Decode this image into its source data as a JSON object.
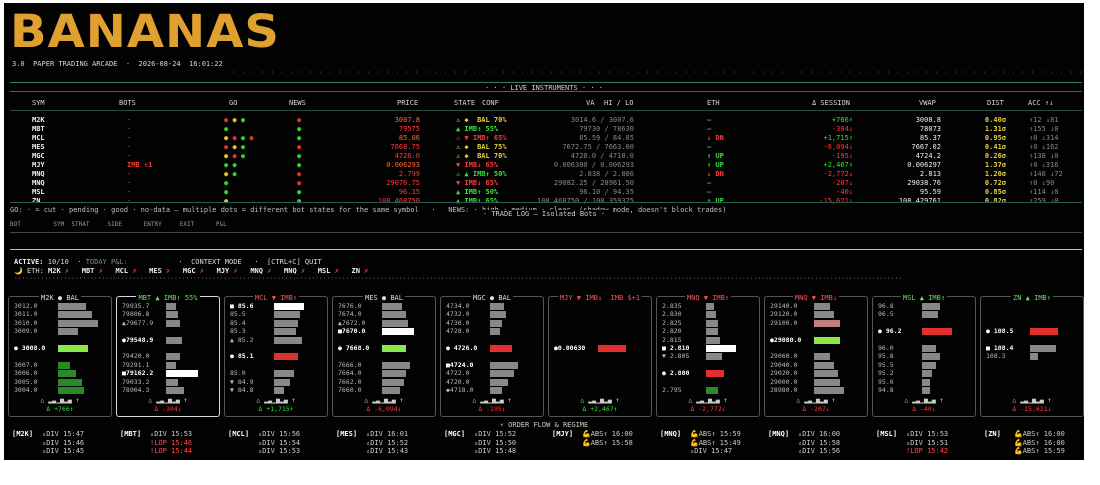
{
  "header": {
    "logo": "BANANAS",
    "version": "3.0",
    "subtitle": "PAPER TRADING ARCADE",
    "separator": "·",
    "datetime": "2026-08-24  16:01:22",
    "dots": "· · · · · · · · · · · · · · · · · · · · · · · · · · · · · · · · · · · · · · · · · · · · · · · · · · · · · · · · · · · · · · · · · · · · · · · · · · · · · · · · · · · · · · · · · · · · · · · · · · · · · · · · · · · · · · · · · · · · · · · · · · · · · · ·"
  },
  "live": {
    "title": "· · · LIVE INSTRUMENTS · · ·",
    "columns": [
      "SYM",
      "BOTS",
      "GO",
      "NEWS",
      "PRICE",
      "STATE",
      "CONF",
      "VA",
      "HI / LO",
      "ETH",
      "Δ SESSION",
      "VWAP",
      "DIST",
      "ACC ↑↓"
    ],
    "rows": [
      {
        "sym": "M2K",
        "bots": "·",
        "go": "● ● ●",
        "news": "●",
        "price": "3007.8",
        "state": "⚠ ◆  BAL 70%",
        "va": "3014.6 / 3007.6",
        "hilo": "",
        "eth": "—",
        "delta": "+766↑",
        "vwap": "3008.8",
        "dist": "0.40σ",
        "acc": "↑12 ↓81"
      },
      {
        "sym": "MBT",
        "bots": "·",
        "go": "●",
        "news": "●",
        "price": "79575",
        "state": "▲ IMB↑ 55%",
        "va": "79730 / 78630",
        "hilo": "",
        "eth": "—",
        "delta": "-304↓",
        "vwap": "78073",
        "dist": "1.31σ",
        "acc": "↑155 ↓0"
      },
      {
        "sym": "MCL",
        "bots": "·",
        "go": "● ● ● ●",
        "news": "●",
        "price": "85.06",
        "state": "⚠ ▼ IMB↑ 65%",
        "va": "85.59 / 84.85",
        "hilo": "",
        "eth": "↓ DN",
        "delta": "+1,715↑",
        "vwap": "85.37",
        "dist": "0.95σ",
        "acc": "↑0 ↓314"
      },
      {
        "sym": "MES",
        "bots": "·",
        "go": "● ● ●",
        "news": "●",
        "price": "7668.75",
        "state": "⚠ ◆  BAL 75%",
        "va": "7672.75 / 7663.00",
        "hilo": "",
        "eth": "—",
        "delta": "-6,094↓",
        "vwap": "7667.02",
        "dist": "0.41σ",
        "acc": "↑0 ↓162"
      },
      {
        "sym": "MGC",
        "bots": "·",
        "go": "● ● ●",
        "news": "●",
        "price": "4726.0",
        "state": "⚠ ◆  BAL 70%",
        "va": "4728.0 / 4710.0",
        "hilo": "",
        "eth": "↑ UP",
        "delta": "-195↓",
        "vwap": "4724.2",
        "dist": "0.26σ",
        "acc": "↑138 ↓0"
      },
      {
        "sym": "MJY",
        "bots": "IMB ↑1",
        "go": "● ●",
        "news": "●",
        "price": "0.006293",
        "state": "▼ IMB↓ 65%",
        "va": "0.006300 / 0.006293",
        "hilo": "",
        "eth": "↑ UP",
        "delta": "+2,467↑",
        "vwap": "0.006297",
        "dist": "1.37σ",
        "acc": "↑0 ↓316"
      },
      {
        "sym": "MNQ",
        "bots": "·",
        "go": "● ●",
        "news": "●",
        "price": "2.799",
        "state": "⚠ ▲ IMB↑ 50%",
        "va": "2.838 / 2.806",
        "hilo": "",
        "eth": "↓ DN",
        "delta": "-2,772↓",
        "vwap": "2.813",
        "dist": "1.20σ",
        "acc": "↑148 ↓72"
      },
      {
        "sym": "MNQ",
        "bots": "·",
        "go": "●",
        "news": "●",
        "price": "29076.75",
        "state": "▼ IMB↓ 65%",
        "va": "29082.25 / 28961.50",
        "hilo": "",
        "eth": "—",
        "delta": "-207↓",
        "vwap": "29038.76",
        "dist": "0.72σ",
        "acc": "↑0 ↓90"
      },
      {
        "sym": "MSL",
        "bots": "·",
        "go": "●",
        "news": "●",
        "price": "96.15",
        "state": "▲ IMB↑ 50%",
        "va": "96.10 / 94.35",
        "hilo": "",
        "eth": "—",
        "delta": "-40↓",
        "vwap": "95.59",
        "dist": "0.85σ",
        "acc": "↑114 ↓0"
      },
      {
        "sym": "ZN",
        "bots": "·",
        "go": "●",
        "news": "●",
        "price": "108.468750",
        "state": "▲ IMB↑ 65%",
        "va": "108.468750 / 108.359375",
        "hilo": "",
        "eth": "↑ UP",
        "delta": "-15,621↓",
        "vwap": "108.429761",
        "dist": "0.82σ",
        "acc": "↑259 ↓0"
      }
    ],
    "legend": "GO: · = cut · pending · good · no-data — multiple dots = different bot states for the same symbol   ·   NEWS: · high · medium · clear  (shadow mode, doesn't block trades)"
  },
  "tradelog": {
    "title": "· TRADE LOG — Isolated Bots ·",
    "columns": "BOT         SYM  STRAT     SIDE      ENTRY     EXIT      P&L"
  },
  "status": {
    "active": "ACTIVE:",
    "active_val": "10/10",
    "sep": "·",
    "today": "TODAY P&L:",
    "today_val": "",
    "context": "CONTEXT MODE",
    "quit": "[CTRL+C] QUIT",
    "eth_label": "ETH:",
    "eth_items": [
      "M2K ✗",
      "MBT ✗",
      "MCL ✗",
      "MES ✗",
      "MGC ✗",
      "MJY ✗",
      "MNQ ✗",
      "MNQ ✗",
      "MSL ✗",
      "ZN ✗"
    ]
  },
  "panels": [
    {
      "title": "M2K ● BAL",
      "foot": "Δ +766↑",
      "sel": false
    },
    {
      "title": "MBT ▲ IMB↑ 55%",
      "foot": "Δ -304↓",
      "sel": true
    },
    {
      "title": "MCL ▼ IMB↑",
      "foot": "Δ +1,715↑",
      "sel": false
    },
    {
      "title": "MES ● BAL",
      "foot": "Δ -6,094↓",
      "sel": false
    },
    {
      "title": "MGC ● BAL",
      "foot": "Δ -195↓",
      "sel": false
    },
    {
      "title": "MJY ▼ IMB↓  IMB $+1",
      "foot": "Δ +2,467↑",
      "sel": false
    },
    {
      "title": "MNQ ▼ IMB↑",
      "foot": "Δ -2,772↓",
      "sel": false
    },
    {
      "title": "MNQ ▼ IMB↓",
      "foot": "Δ -207↓",
      "sel": false
    },
    {
      "title": "MSL ▲ IMB↑",
      "foot": "Δ -40↓",
      "sel": false
    },
    {
      "title": "ZN ▲ IMB↑",
      "foot": "Δ -15,621↓",
      "sel": false
    }
  ],
  "panel_levels": [
    [
      [
        "3012.0",
        "#888",
        28
      ],
      [
        "3011.0",
        "#888",
        34
      ],
      [
        "3010.0",
        "#888",
        40
      ],
      [
        "3009.0",
        "#888",
        20
      ],
      [
        "",
        null,
        0
      ],
      [
        "● 3008.0",
        "#8fe84a",
        30
      ],
      [
        "",
        null,
        0
      ],
      [
        "3007.0",
        "#2a8a2a",
        12
      ],
      [
        "3006.0",
        "#2a8a2a",
        18
      ],
      [
        "3005.0",
        "#2a8a2a",
        24
      ],
      [
        "3004.0",
        "#2a8a2a",
        26
      ]
    ],
    [
      [
        "79935.7",
        "#888",
        10
      ],
      [
        "79806.8",
        "#888",
        12
      ],
      [
        "▲79677.9",
        "#888",
        14
      ],
      [
        "",
        null,
        0
      ],
      [
        "●79548.9",
        "#888",
        16
      ],
      [
        "",
        null,
        0
      ],
      [
        "79420.0",
        "#888",
        14
      ],
      [
        "79291.1",
        "#888",
        10
      ],
      [
        "■79162.2",
        "#fff",
        32
      ],
      [
        "79033.2",
        "#888",
        12
      ],
      [
        "78904.3",
        "#888",
        18
      ]
    ],
    [
      [
        "■ 85.6",
        "#fff",
        30
      ],
      [
        "85.5",
        "#888",
        26
      ],
      [
        "85.4",
        "#888",
        24
      ],
      [
        "85.3",
        "#888",
        22
      ],
      [
        "▲ 85.2",
        "#888",
        28
      ],
      [
        "",
        null,
        0
      ],
      [
        "● 85.1",
        "#e03030",
        24
      ],
      [
        "",
        null,
        0
      ],
      [
        "85.0",
        "#888",
        20
      ],
      [
        "▼ 84.9",
        "#888",
        16
      ],
      [
        "▼ 84.8",
        "#888",
        10
      ]
    ],
    [
      [
        "7676.0",
        "#888",
        20
      ],
      [
        "7674.0",
        "#888",
        24
      ],
      [
        "▲7672.0",
        "#888",
        26
      ],
      [
        "■7670.0",
        "#fff",
        32
      ],
      [
        "",
        null,
        0
      ],
      [
        "● 7668.0",
        "#8fe84a",
        24
      ],
      [
        "",
        null,
        0
      ],
      [
        "7666.0",
        "#888",
        28
      ],
      [
        "7664.0",
        "#888",
        24
      ],
      [
        "7662.0",
        "#888",
        22
      ],
      [
        "7660.0",
        "#888",
        18
      ]
    ],
    [
      [
        "4734.0",
        "#888",
        14
      ],
      [
        "4732.0",
        "#888",
        16
      ],
      [
        "4730.0",
        "#888",
        12
      ],
      [
        "4728.0",
        "#888",
        10
      ],
      [
        "",
        null,
        0
      ],
      [
        "● 4726.0",
        "#e03030",
        22
      ],
      [
        "",
        null,
        0
      ],
      [
        "■4724.0",
        "#888",
        28
      ],
      [
        "4722.0",
        "#888",
        24
      ],
      [
        "4720.0",
        "#888",
        18
      ],
      [
        "◆4718.0",
        "#888",
        12
      ]
    ],
    [
      [
        "",
        null,
        0
      ],
      [
        "",
        null,
        0
      ],
      [
        "",
        null,
        0
      ],
      [
        "",
        null,
        0
      ],
      [
        "",
        null,
        0
      ],
      [
        "●0.00630",
        "#e03030",
        28
      ],
      [
        "",
        null,
        0
      ],
      [
        "",
        null,
        0
      ],
      [
        "",
        null,
        0
      ],
      [
        "",
        null,
        0
      ],
      [
        "",
        null,
        0
      ]
    ],
    [
      [
        "2.835",
        "#888",
        8
      ],
      [
        "2.830",
        "#888",
        10
      ],
      [
        "2.825",
        "#888",
        12
      ],
      [
        "2.820",
        "#888",
        12
      ],
      [
        "2.815",
        "#888",
        14
      ],
      [
        "■ 2.810",
        "#fff",
        30
      ],
      [
        "▼ 2.805",
        "#888",
        16
      ],
      [
        "",
        null,
        0
      ],
      [
        "● 2.800",
        "#e03030",
        18
      ],
      [
        "",
        null,
        0
      ],
      [
        "2.795",
        "#2a8a2a",
        12
      ]
    ],
    [
      [
        "29140.0",
        "#888",
        16
      ],
      [
        "29120.0",
        "#888",
        20
      ],
      [
        "29100.0",
        "#c08080",
        26
      ],
      [
        "",
        null,
        0
      ],
      [
        "●29080.0",
        "#8fe84a",
        26
      ],
      [
        "",
        null,
        0
      ],
      [
        "29060.0",
        "#888",
        16
      ],
      [
        "29040.0",
        "#888",
        20
      ],
      [
        "29020.0",
        "#888",
        24
      ],
      [
        "29000.0",
        "#888",
        26
      ],
      [
        "28980.0",
        "#888",
        30
      ]
    ],
    [
      [
        "96.8",
        "#888",
        18
      ],
      [
        "96.5",
        "#888",
        16
      ],
      [
        "",
        null,
        0
      ],
      [
        "● 96.2",
        "#e03030",
        30
      ],
      [
        "",
        null,
        0
      ],
      [
        "96.0",
        "#888",
        14
      ],
      [
        "95.8",
        "#888",
        18
      ],
      [
        "95.5",
        "#888",
        14
      ],
      [
        "95.2",
        "#888",
        10
      ],
      [
        "95.0",
        "#888",
        8
      ],
      [
        "94.8",
        "#888",
        8
      ]
    ],
    [
      [
        "",
        null,
        0
      ],
      [
        "",
        null,
        0
      ],
      [
        "",
        null,
        0
      ],
      [
        "● 108.5",
        "#e03030",
        28
      ],
      [
        "",
        null,
        0
      ],
      [
        "■ 108.4",
        "#888",
        26
      ],
      [
        "108.3",
        "#888",
        8
      ],
      [
        "",
        null,
        0
      ],
      [
        "",
        null,
        0
      ],
      [
        "",
        null,
        0
      ],
      [
        "",
        null,
        0
      ]
    ]
  ],
  "orderflow": {
    "title": "⚡ ORDER FLOW & REGIME",
    "groups": [
      {
        "sym": "[M2K]",
        "lines": [
          [
            "▵DIV 15:47",
            "#ccc"
          ],
          [
            "▵DIV 15:46",
            "#ccc"
          ],
          [
            "▵DIV 15:45",
            "#ccc"
          ]
        ]
      },
      {
        "sym": "[MBT]",
        "lines": [
          [
            "▵DIV 15:53",
            "#ccc"
          ],
          [
            "!LOP 15:46",
            "#ff4a4a"
          ],
          [
            "!LOP 15:44",
            "#ff4a4a"
          ]
        ]
      },
      {
        "sym": "[MCL]",
        "lines": [
          [
            "▵DIV 15:56",
            "#ccc"
          ],
          [
            "▵DIV 15:54",
            "#ccc"
          ],
          [
            "▵DIV 15:53",
            "#ccc"
          ]
        ]
      },
      {
        "sym": "[MES]",
        "lines": [
          [
            "▵DIV 16:01",
            "#ccc"
          ],
          [
            "▵DIV 15:52",
            "#ccc"
          ],
          [
            "▵DIV 15:43",
            "#ccc"
          ]
        ]
      },
      {
        "sym": "[MGC]",
        "lines": [
          [
            "▵DIV 15:52",
            "#ccc"
          ],
          [
            "▵DIV 15:50",
            "#ccc"
          ],
          [
            "▵DIV 15:48",
            "#ccc"
          ]
        ]
      },
      {
        "sym": "[MJY]",
        "lines": [
          [
            "💪ABS↑ 16:00",
            "#ccc"
          ],
          [
            "💪ABS↑ 15:58",
            "#ccc"
          ]
        ]
      },
      {
        "sym": "[MNQ]",
        "lines": [
          [
            "💪ABS↑ 15:59",
            "#ccc"
          ],
          [
            "💪ABS↑ 15:49",
            "#ccc"
          ],
          [
            "▵DIV 15:47",
            "#ccc"
          ]
        ]
      },
      {
        "sym": "[MNQ]",
        "lines": [
          [
            "▵DIV 16:00",
            "#ccc"
          ],
          [
            "▵DIV 15:58",
            "#ccc"
          ],
          [
            "▵DIV 15:56",
            "#ccc"
          ]
        ]
      },
      {
        "sym": "[MSL]",
        "lines": [
          [
            "▵DIV 15:53",
            "#ccc"
          ],
          [
            "▵DIV 15:51",
            "#ccc"
          ],
          [
            "!LOP 15:42",
            "#ff4a4a"
          ]
        ]
      },
      {
        "sym": "[ZN]",
        "lines": [
          [
            "💪ABS↑ 16:00",
            "#ccc"
          ],
          [
            "💪ABS↑ 16:00",
            "#ccc"
          ],
          [
            "💪ABS↑ 15:59",
            "#ccc"
          ]
        ]
      }
    ]
  },
  "colors": {
    "accent": "#e0a030",
    "green": "#38e038",
    "red": "#ff3a3a",
    "rule": "#3a7a6a"
  }
}
